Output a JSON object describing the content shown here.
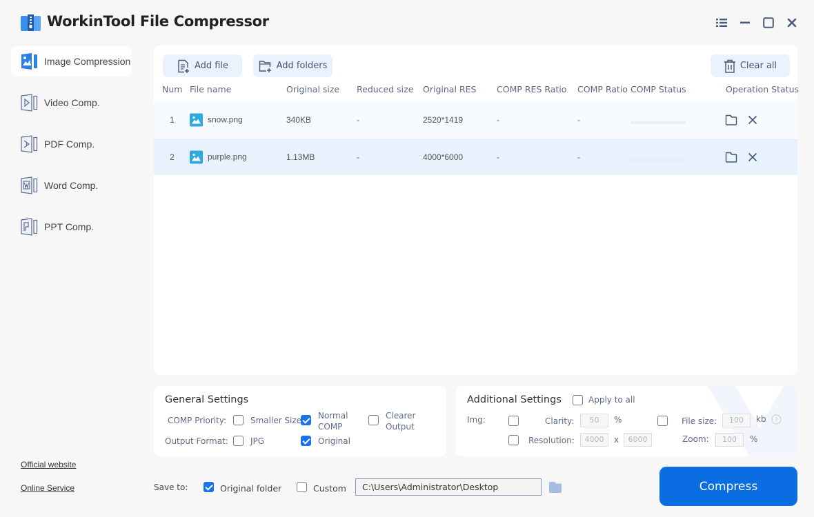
{
  "app": {
    "title": "WorkinTool File Compressor"
  },
  "window_controls": [
    "menu-icon",
    "minimize-icon",
    "maximize-icon",
    "close-icon"
  ],
  "sidebar": {
    "items": [
      {
        "label": "Image Compression",
        "icon": "image-comp-icon",
        "active": true
      },
      {
        "label": "Video Comp.",
        "icon": "video-comp-icon",
        "active": false
      },
      {
        "label": "PDF Comp.",
        "icon": "pdf-comp-icon",
        "active": false
      },
      {
        "label": "Word Comp.",
        "icon": "word-comp-icon",
        "active": false
      },
      {
        "label": "PPT Comp.",
        "icon": "ppt-comp-icon",
        "active": false
      }
    ],
    "links": {
      "official_website": "Official website",
      "online_service": "Online Service"
    }
  },
  "toolbar": {
    "add_file": "Add file",
    "add_folders": "Add folders",
    "clear_all": "Clear all"
  },
  "table": {
    "columns": [
      "Num",
      "File name",
      "Original size",
      "Reduced size",
      "Original RES",
      "COMP RES Ratio",
      "COMP Ratio",
      "COMP Status",
      "Operation Status"
    ],
    "rows": [
      {
        "num": "1",
        "file_name": "snow.png",
        "original_size": "340KB",
        "reduced_size": "-",
        "original_res": "2520*1419",
        "comp_res_ratio": "-",
        "comp_ratio": "-",
        "progress": 0
      },
      {
        "num": "2",
        "file_name": "purple.png",
        "original_size": "1.13MB",
        "reduced_size": "-",
        "original_res": "4000*6000",
        "comp_res_ratio": "-",
        "comp_ratio": "-",
        "progress": 0
      }
    ]
  },
  "general_settings": {
    "title": "General Settings",
    "comp_priority_label": "COMP Priority:",
    "priority_options": [
      {
        "label": "Smaller Size",
        "checked": false
      },
      {
        "label": "Normal COMP",
        "checked": true
      },
      {
        "label": "Clearer Output",
        "checked": false
      }
    ],
    "output_format_label": "Output Format:",
    "format_options": [
      {
        "label": "JPG",
        "checked": false
      },
      {
        "label": "Original",
        "checked": true
      }
    ]
  },
  "additional_settings": {
    "title": "Additional Settings",
    "apply_to_all": {
      "label": "Apply to all",
      "checked": false
    },
    "img_label": "Img:",
    "clarity": {
      "label": "Clarity:",
      "value": "50",
      "unit": "%",
      "checked": false
    },
    "resolution": {
      "label": "Resolution:",
      "width": "4000",
      "sep": "x",
      "height": "6000",
      "checked": false
    },
    "file_size": {
      "label": "File size:",
      "value": "100",
      "unit": "kb",
      "checked": false
    },
    "zoom": {
      "label": "Zoom:",
      "value": "100",
      "unit": "%"
    }
  },
  "save": {
    "label": "Save to:",
    "original_folder": {
      "label": "Original folder",
      "checked": true
    },
    "custom": {
      "label": "Custom",
      "checked": false
    },
    "path": "C:\\Users\\Administrator\\Desktop"
  },
  "compress_button": "Compress",
  "colors": {
    "accent": "#0a6de2",
    "checkbox_on": "#1a73e8",
    "toolbar_btn_bg": "#eaf3fd",
    "selected_row_bg": "#e8f2fd",
    "row_bg": "#f7fafe",
    "file_icon": "#2fa8e0"
  }
}
